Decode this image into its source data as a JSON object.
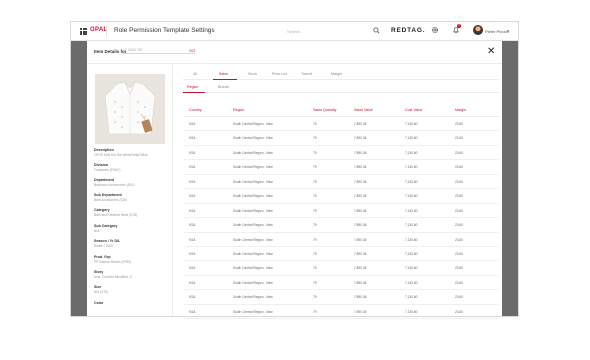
{
  "app": {
    "brand": "OPAL",
    "title": "Role Permission Template Settings",
    "search_placeholder": "Search...",
    "logo_text": "REDTAG.",
    "notification_count": "3",
    "user_name": "Pieter Pindun",
    "icons": {
      "menu": "grid-icon",
      "search": "search-icon",
      "settings": "gear-icon",
      "notifications": "bell-icon",
      "user_menu": "chevron-down-icon",
      "close": "close-icon"
    }
  },
  "panel": {
    "item_label": "Item Details for",
    "item_value": "12 3456 789",
    "go_label": "GO",
    "close_glyph": "✕",
    "details": [
      {
        "label": "Description",
        "value": "OPCE Kids Kid Tee White/Detail Wide"
      },
      {
        "label": "Division",
        "value": "Footwears (FW10)"
      },
      {
        "label": "Department",
        "value": "Bathroom Accessories (B10)"
      },
      {
        "label": "Sub Department",
        "value": "Bath Accessories (S20)"
      },
      {
        "label": "Category",
        "value": "Bath and Polished Bede (D78)"
      },
      {
        "label": "Sub Category",
        "value": "N/A"
      },
      {
        "label": "Season / Yr D/L",
        "value": "Winter / 2019"
      },
      {
        "label": "Prod. Grp",
        "value": "PP Fashion Basics (P035)"
      },
      {
        "label": "Story",
        "value": "Ancr. Creative Mindfield -S"
      },
      {
        "label": "Size",
        "value": "N/A (X78)"
      },
      {
        "label": "Color",
        "value": ""
      }
    ],
    "tabs": [
      {
        "label": "All",
        "active": false
      },
      {
        "label": "Sales",
        "active": true
      },
      {
        "label": "Stock",
        "active": false
      },
      {
        "label": "Price List",
        "active": false
      },
      {
        "label": "Transit",
        "active": false
      },
      {
        "label": "Margin",
        "active": false
      }
    ],
    "subtabs": [
      {
        "label": "Region",
        "active": true
      },
      {
        "label": "Branch",
        "active": false
      }
    ],
    "table": {
      "columns": [
        "Country",
        "Region",
        "Sales Quantity",
        "Sales Value",
        "Cost Value",
        "Margin"
      ],
      "rows": [
        [
          "KSA",
          "South Central Region - New",
          "79",
          "7,890.36",
          "7,130.60",
          "23.60"
        ],
        [
          "KSA",
          "South Central Region - New",
          "79",
          "7,890.36",
          "7,130.60",
          "23.60"
        ],
        [
          "KSA",
          "South Central Region - New",
          "79",
          "7,890.36",
          "7,130.60",
          "23.60"
        ],
        [
          "KSA",
          "South Central Region - New",
          "79",
          "7,890.36",
          "7,130.60",
          "23.60"
        ],
        [
          "KSA",
          "South Central Region - New",
          "79",
          "7,890.36",
          "7,130.60",
          "23.60"
        ],
        [
          "KSA",
          "South Central Region - New",
          "79",
          "7,890.36",
          "7,130.60",
          "23.60"
        ],
        [
          "KSA",
          "South Central Region - New",
          "79",
          "7,890.36",
          "7,130.60",
          "23.60"
        ],
        [
          "KSA",
          "South Central Region - New",
          "79",
          "7,890.36",
          "7,130.60",
          "23.60"
        ],
        [
          "KSA",
          "South Central Region - New",
          "79",
          "7,890.36",
          "7,130.60",
          "23.60"
        ],
        [
          "KSA",
          "South Central Region - New",
          "79",
          "7,890.36",
          "7,130.60",
          "23.60"
        ],
        [
          "KSA",
          "South Central Region - New",
          "79",
          "7,890.36",
          "7,130.60",
          "23.60"
        ],
        [
          "KSA",
          "South Central Region - New",
          "79",
          "7,890.36",
          "7,130.60",
          "23.60"
        ],
        [
          "KSA",
          "South Central Region - New",
          "79",
          "7,890.36",
          "7,130.60",
          "23.60"
        ],
        [
          "KSA",
          "South Central Region - New",
          "79",
          "7,890.36",
          "7,130.60",
          "23.60"
        ]
      ]
    }
  },
  "colors": {
    "accent": "#c8102e",
    "overlay": "#6b6b6b",
    "text": "#333333"
  }
}
